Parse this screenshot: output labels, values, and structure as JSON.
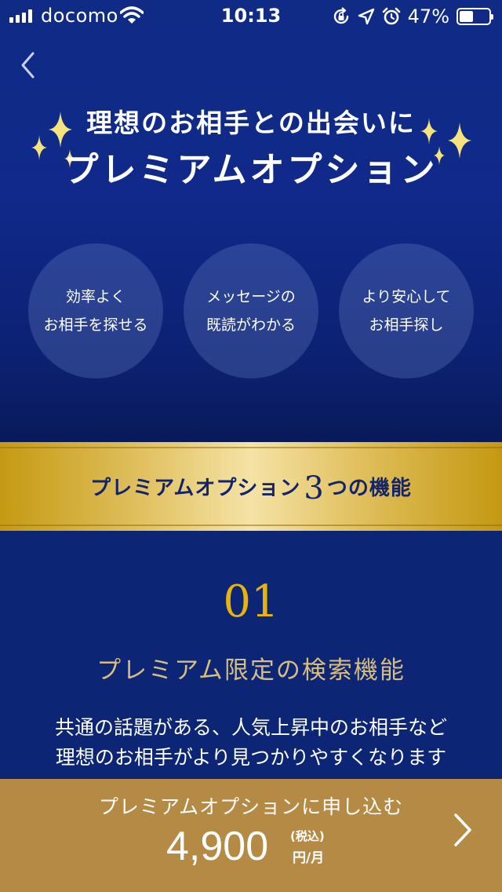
{
  "status_bar": {
    "carrier": "docomo",
    "time": "10:13",
    "battery_percent": "47%",
    "battery_level": 0.47,
    "icons": [
      "signal-bars-icon",
      "wifi-icon",
      "orientation-lock-icon",
      "location-arrow-icon",
      "alarm-icon",
      "battery-icon"
    ]
  },
  "header": {
    "back_icon": "chevron-left-icon"
  },
  "hero": {
    "line1": "理想のお相手との出会いに",
    "line2": "プレミアムオプション",
    "decoration_icon": "sparkle-icon",
    "benefits": [
      {
        "line1": "効率よく",
        "line2": "お相手を探せる"
      },
      {
        "line1": "メッセージの",
        "line2": "既読がわかる"
      },
      {
        "line1": "より安心して",
        "line2": "お相手探し"
      }
    ]
  },
  "band": {
    "prefix": "プレミアムオプション",
    "number": "3",
    "suffix": "つの機能"
  },
  "feature": {
    "number": "01",
    "title": "プレミアム限定の検索機能",
    "desc_line1": "共通の話題がある、人気上昇中のお相手など",
    "desc_line2": "理想のお相手がより見つかりやすくなります"
  },
  "cta": {
    "label": "プレミアムオプションに申し込む",
    "price": "4,900",
    "tax_note": "(税込)",
    "unit": "円/月",
    "chevron_icon": "chevron-right-icon"
  },
  "colors": {
    "hero_blue": "#0f2b86",
    "section_blue": "#0c2574",
    "gold": "#e2c366",
    "feature_number_gold": "#e7b40e",
    "feature_title_beige": "#d8bd80",
    "cta_brown": "#b58a45",
    "band_text_navy": "#14246a"
  }
}
